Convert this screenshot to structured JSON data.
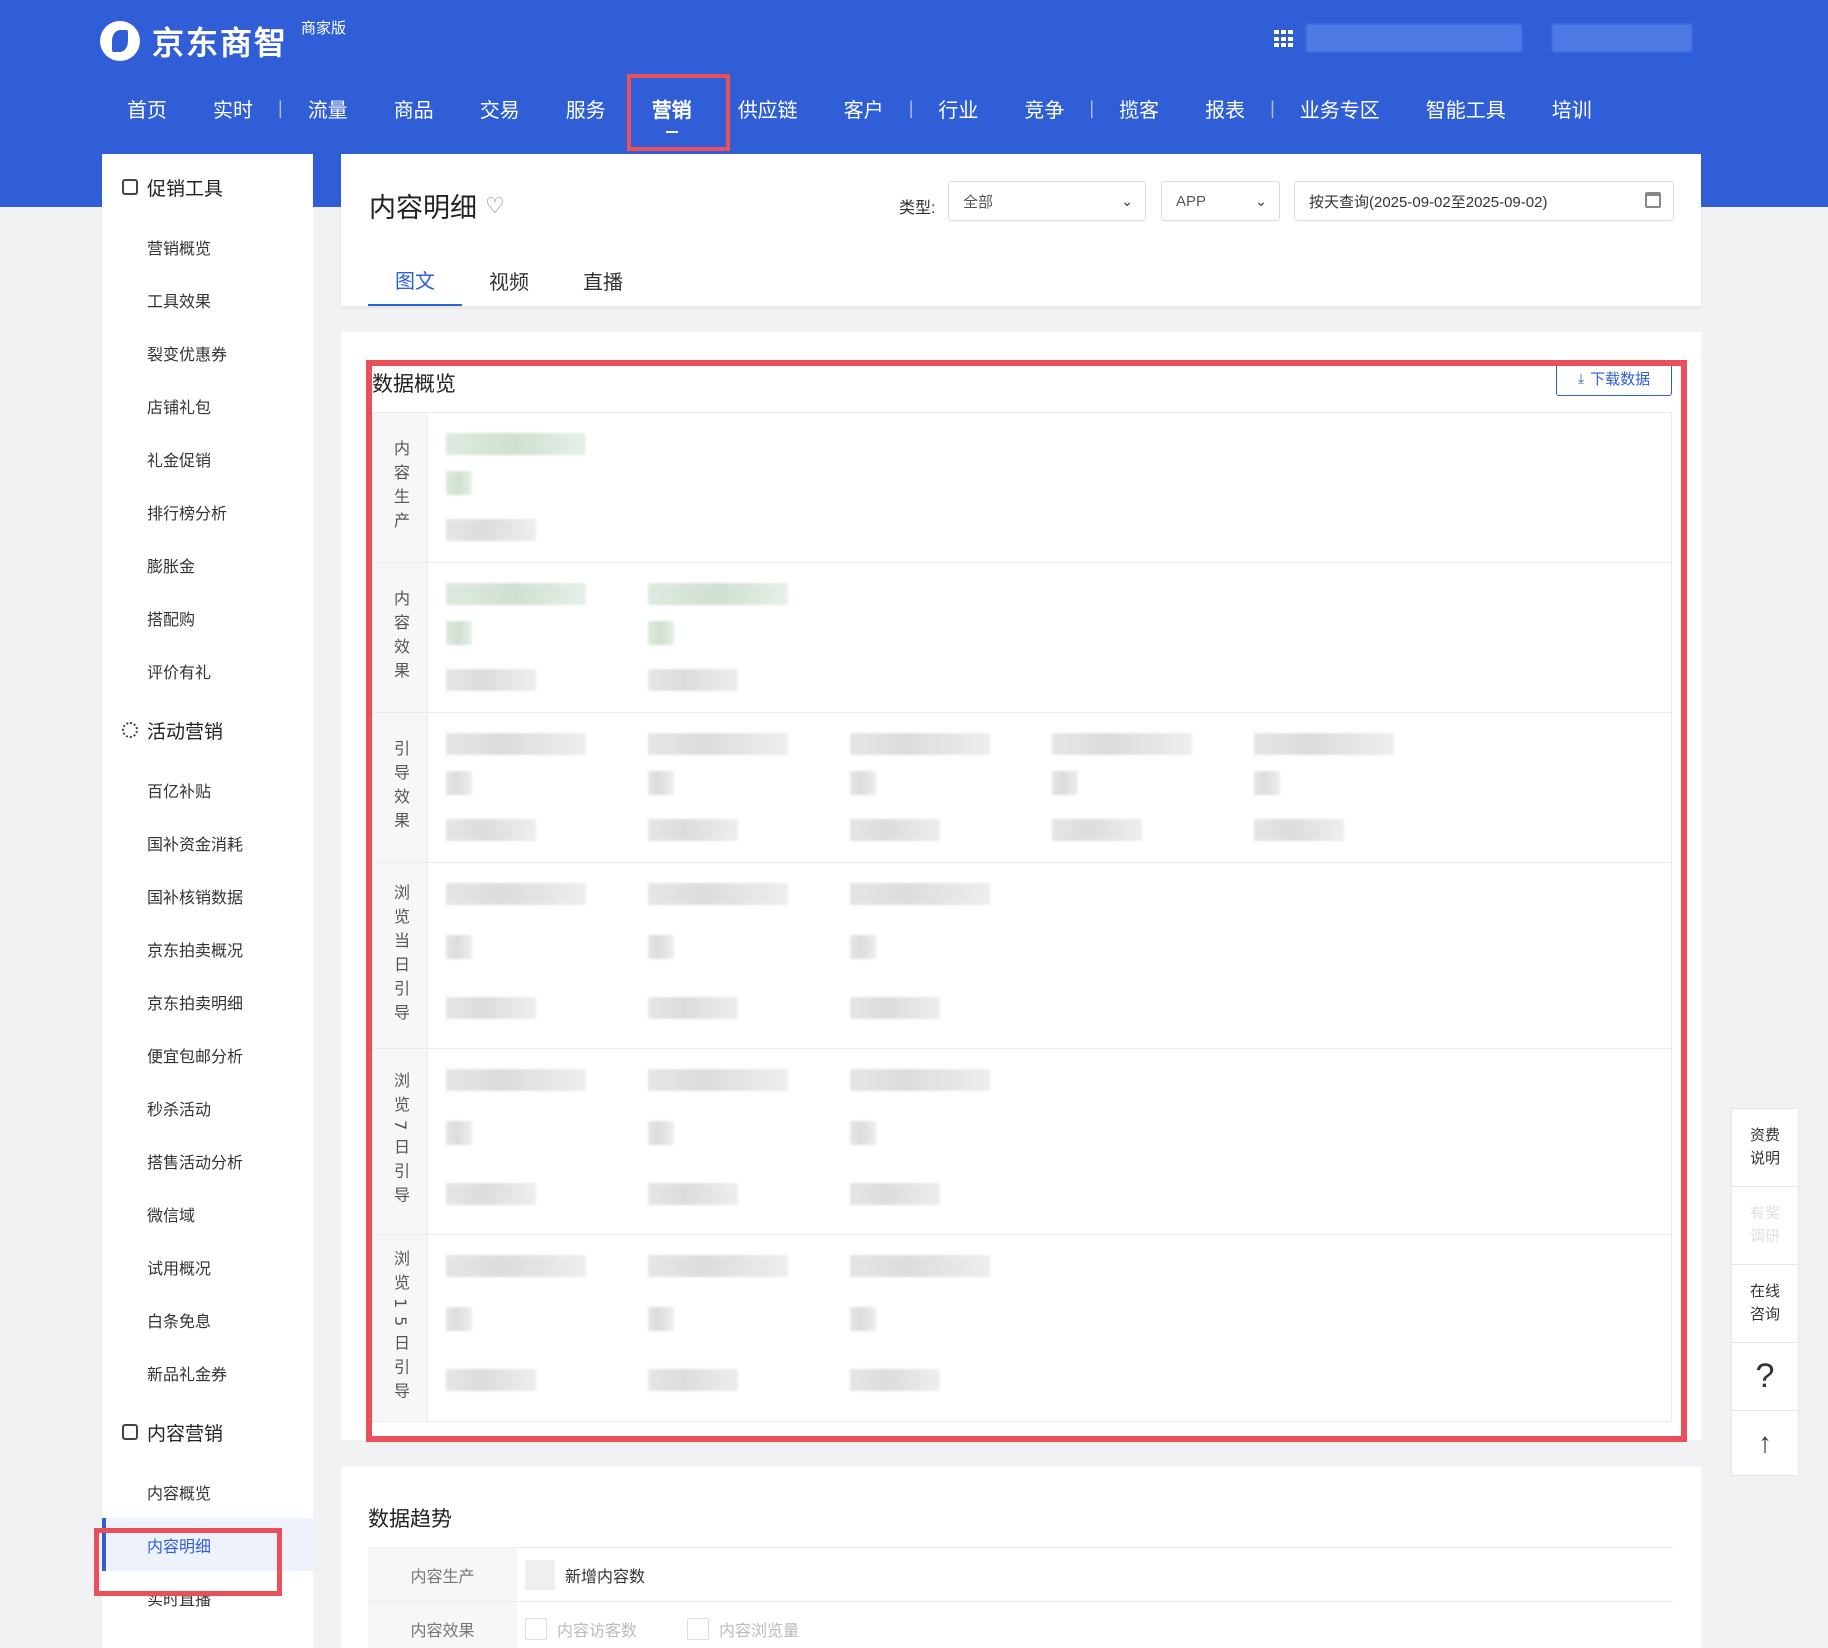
{
  "header": {
    "logo_text": "京东商智",
    "edition": "商家版",
    "nav": [
      {
        "label": "首页"
      },
      {
        "label": "实时"
      },
      {
        "sep": "|"
      },
      {
        "label": "流量"
      },
      {
        "label": "商品"
      },
      {
        "label": "交易"
      },
      {
        "label": "服务"
      },
      {
        "label": "营销",
        "active": true
      },
      {
        "label": "供应链"
      },
      {
        "label": "客户"
      },
      {
        "sep": "|"
      },
      {
        "label": "行业"
      },
      {
        "label": "竞争"
      },
      {
        "sep": "|"
      },
      {
        "label": "揽客"
      },
      {
        "label": "报表"
      },
      {
        "sep": "|"
      },
      {
        "label": "业务专区"
      },
      {
        "label": "智能工具"
      },
      {
        "label": "培训"
      }
    ]
  },
  "sidebar": {
    "groups": [
      {
        "title": "促销工具",
        "icon": "promo-tool-icon",
        "items": [
          "营销概览",
          "工具效果",
          "裂变优惠券",
          "店铺礼包",
          "礼金促销",
          "排行榜分析",
          "膨胀金",
          "搭配购",
          "评价有礼"
        ]
      },
      {
        "title": "活动营销",
        "icon": "activity-gear-icon",
        "items": [
          "百亿补贴",
          "国补资金消耗",
          "国补核销数据",
          "京东拍卖概况",
          "京东拍卖明细",
          "便宜包邮分析",
          "秒杀活动",
          "搭售活动分析",
          "微信域",
          "试用概况",
          "白条免息",
          "新品礼金券"
        ]
      },
      {
        "title": "内容营销",
        "icon": "content-doc-icon",
        "items": [
          "内容概览",
          "内容明细",
          "实时直播"
        ]
      }
    ],
    "active_item": "内容明细"
  },
  "page": {
    "title": "内容明细",
    "filter_label": "类型:",
    "type_select": "全部",
    "platform_select": "APP",
    "date_range": "按天查询(2025-09-02至2025-09-02)",
    "tabs": [
      {
        "label": "图文",
        "active": true
      },
      {
        "label": "视频"
      },
      {
        "label": "直播"
      }
    ]
  },
  "overview": {
    "title": "数据概览",
    "download_label": "下载数据",
    "rows": [
      {
        "label": "内容生产",
        "cells": 1,
        "height": 150,
        "tone": "green"
      },
      {
        "label": "内容效果",
        "cells": 2,
        "height": 150,
        "tone": "green"
      },
      {
        "label": "引导效果",
        "cells": 5,
        "height": 150,
        "tone": "gray"
      },
      {
        "label": "浏览当日引导",
        "cells": 3,
        "height": 186,
        "tone": "gray"
      },
      {
        "label": "浏览7日引导",
        "cells": 3,
        "height": 186,
        "tone": "gray"
      },
      {
        "label": "浏览15日引导",
        "cells": 3,
        "height": 186,
        "tone": "gray"
      }
    ]
  },
  "trend": {
    "title": "数据趋势",
    "rows": [
      {
        "label": "内容生产",
        "options": [
          {
            "label": "新增内容数",
            "dim": false
          }
        ]
      },
      {
        "label": "内容效果",
        "options": [
          {
            "label": "内容访客数",
            "dim": true
          },
          {
            "label": "内容浏览量",
            "dim": true
          }
        ]
      }
    ]
  },
  "float_bar": {
    "fee": "资费说明",
    "survey": "有奖调研",
    "consult": "在线咨询",
    "help": "?",
    "top": "↑"
  }
}
